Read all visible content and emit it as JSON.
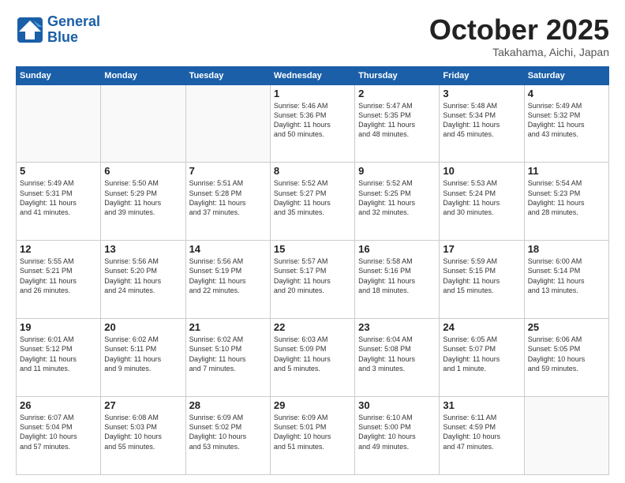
{
  "header": {
    "logo_line1": "General",
    "logo_line2": "Blue",
    "month": "October 2025",
    "location": "Takahama, Aichi, Japan"
  },
  "weekdays": [
    "Sunday",
    "Monday",
    "Tuesday",
    "Wednesday",
    "Thursday",
    "Friday",
    "Saturday"
  ],
  "weeks": [
    [
      {
        "num": "",
        "info": ""
      },
      {
        "num": "",
        "info": ""
      },
      {
        "num": "",
        "info": ""
      },
      {
        "num": "1",
        "info": "Sunrise: 5:46 AM\nSunset: 5:36 PM\nDaylight: 11 hours\nand 50 minutes."
      },
      {
        "num": "2",
        "info": "Sunrise: 5:47 AM\nSunset: 5:35 PM\nDaylight: 11 hours\nand 48 minutes."
      },
      {
        "num": "3",
        "info": "Sunrise: 5:48 AM\nSunset: 5:34 PM\nDaylight: 11 hours\nand 45 minutes."
      },
      {
        "num": "4",
        "info": "Sunrise: 5:49 AM\nSunset: 5:32 PM\nDaylight: 11 hours\nand 43 minutes."
      }
    ],
    [
      {
        "num": "5",
        "info": "Sunrise: 5:49 AM\nSunset: 5:31 PM\nDaylight: 11 hours\nand 41 minutes."
      },
      {
        "num": "6",
        "info": "Sunrise: 5:50 AM\nSunset: 5:29 PM\nDaylight: 11 hours\nand 39 minutes."
      },
      {
        "num": "7",
        "info": "Sunrise: 5:51 AM\nSunset: 5:28 PM\nDaylight: 11 hours\nand 37 minutes."
      },
      {
        "num": "8",
        "info": "Sunrise: 5:52 AM\nSunset: 5:27 PM\nDaylight: 11 hours\nand 35 minutes."
      },
      {
        "num": "9",
        "info": "Sunrise: 5:52 AM\nSunset: 5:25 PM\nDaylight: 11 hours\nand 32 minutes."
      },
      {
        "num": "10",
        "info": "Sunrise: 5:53 AM\nSunset: 5:24 PM\nDaylight: 11 hours\nand 30 minutes."
      },
      {
        "num": "11",
        "info": "Sunrise: 5:54 AM\nSunset: 5:23 PM\nDaylight: 11 hours\nand 28 minutes."
      }
    ],
    [
      {
        "num": "12",
        "info": "Sunrise: 5:55 AM\nSunset: 5:21 PM\nDaylight: 11 hours\nand 26 minutes."
      },
      {
        "num": "13",
        "info": "Sunrise: 5:56 AM\nSunset: 5:20 PM\nDaylight: 11 hours\nand 24 minutes."
      },
      {
        "num": "14",
        "info": "Sunrise: 5:56 AM\nSunset: 5:19 PM\nDaylight: 11 hours\nand 22 minutes."
      },
      {
        "num": "15",
        "info": "Sunrise: 5:57 AM\nSunset: 5:17 PM\nDaylight: 11 hours\nand 20 minutes."
      },
      {
        "num": "16",
        "info": "Sunrise: 5:58 AM\nSunset: 5:16 PM\nDaylight: 11 hours\nand 18 minutes."
      },
      {
        "num": "17",
        "info": "Sunrise: 5:59 AM\nSunset: 5:15 PM\nDaylight: 11 hours\nand 15 minutes."
      },
      {
        "num": "18",
        "info": "Sunrise: 6:00 AM\nSunset: 5:14 PM\nDaylight: 11 hours\nand 13 minutes."
      }
    ],
    [
      {
        "num": "19",
        "info": "Sunrise: 6:01 AM\nSunset: 5:12 PM\nDaylight: 11 hours\nand 11 minutes."
      },
      {
        "num": "20",
        "info": "Sunrise: 6:02 AM\nSunset: 5:11 PM\nDaylight: 11 hours\nand 9 minutes."
      },
      {
        "num": "21",
        "info": "Sunrise: 6:02 AM\nSunset: 5:10 PM\nDaylight: 11 hours\nand 7 minutes."
      },
      {
        "num": "22",
        "info": "Sunrise: 6:03 AM\nSunset: 5:09 PM\nDaylight: 11 hours\nand 5 minutes."
      },
      {
        "num": "23",
        "info": "Sunrise: 6:04 AM\nSunset: 5:08 PM\nDaylight: 11 hours\nand 3 minutes."
      },
      {
        "num": "24",
        "info": "Sunrise: 6:05 AM\nSunset: 5:07 PM\nDaylight: 11 hours\nand 1 minute."
      },
      {
        "num": "25",
        "info": "Sunrise: 6:06 AM\nSunset: 5:05 PM\nDaylight: 10 hours\nand 59 minutes."
      }
    ],
    [
      {
        "num": "26",
        "info": "Sunrise: 6:07 AM\nSunset: 5:04 PM\nDaylight: 10 hours\nand 57 minutes."
      },
      {
        "num": "27",
        "info": "Sunrise: 6:08 AM\nSunset: 5:03 PM\nDaylight: 10 hours\nand 55 minutes."
      },
      {
        "num": "28",
        "info": "Sunrise: 6:09 AM\nSunset: 5:02 PM\nDaylight: 10 hours\nand 53 minutes."
      },
      {
        "num": "29",
        "info": "Sunrise: 6:09 AM\nSunset: 5:01 PM\nDaylight: 10 hours\nand 51 minutes."
      },
      {
        "num": "30",
        "info": "Sunrise: 6:10 AM\nSunset: 5:00 PM\nDaylight: 10 hours\nand 49 minutes."
      },
      {
        "num": "31",
        "info": "Sunrise: 6:11 AM\nSunset: 4:59 PM\nDaylight: 10 hours\nand 47 minutes."
      },
      {
        "num": "",
        "info": ""
      }
    ]
  ]
}
